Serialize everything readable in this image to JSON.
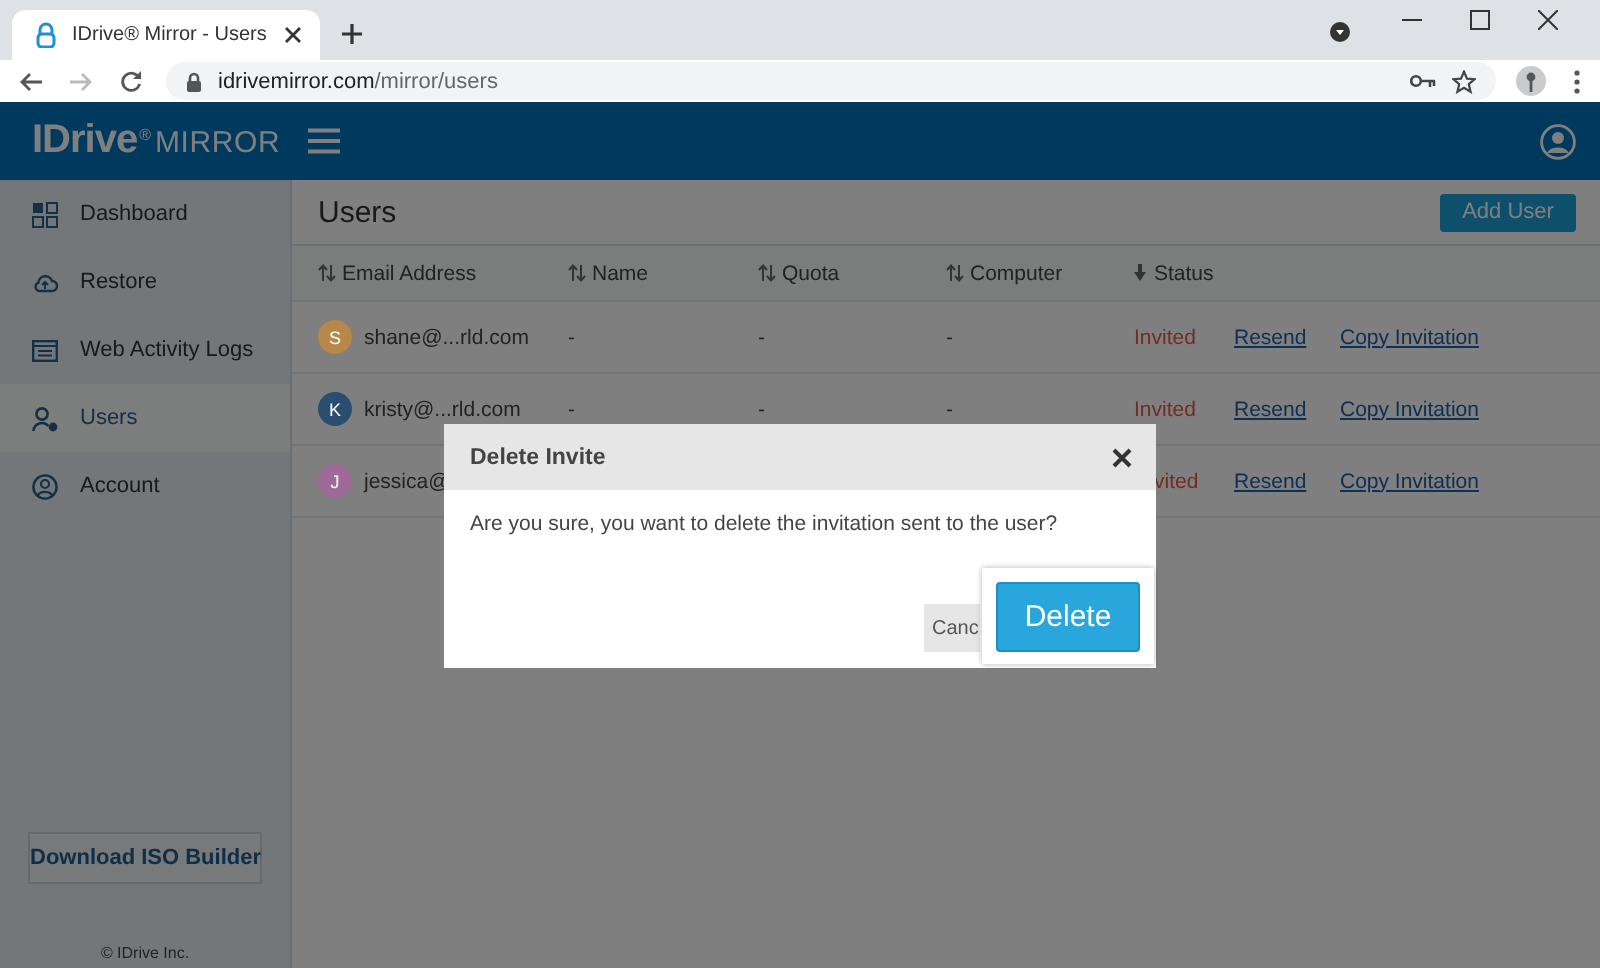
{
  "browser": {
    "tab_title": "IDrive® Mirror - Users",
    "url_host": "idrivemirror.com",
    "url_path": "/mirror/users"
  },
  "header": {
    "logo": "IDrive",
    "logo_mark": "®",
    "product": "MIRROR"
  },
  "sidebar": {
    "items": [
      {
        "label": "Dashboard",
        "selected": false
      },
      {
        "label": "Restore",
        "selected": false
      },
      {
        "label": "Web Activity Logs",
        "selected": false
      },
      {
        "label": "Users",
        "selected": true
      },
      {
        "label": "Account",
        "selected": false
      }
    ],
    "download_button": "Download ISO Builder",
    "footer": "© IDrive Inc."
  },
  "page": {
    "title": "Users",
    "add_button": "Add User"
  },
  "table": {
    "columns": [
      {
        "label": "Email Address",
        "sorted": false
      },
      {
        "label": "Name",
        "sorted": false
      },
      {
        "label": "Quota",
        "sorted": false
      },
      {
        "label": "Computer",
        "sorted": false
      },
      {
        "label": "Status",
        "sorted": true
      }
    ],
    "rows": [
      {
        "kind": "full",
        "initial": "S",
        "color": "#b8884a",
        "email": "shane@...rld.com",
        "name": "-",
        "quota": "-",
        "computer": "-",
        "status": "Invited",
        "actions": [
          "Resend",
          "Copy Invitation"
        ]
      },
      {
        "kind": "full",
        "initial": "K",
        "color": "#2a4d70",
        "email": "kristy@...rld.com",
        "name": "-",
        "quota": "-",
        "computer": "-",
        "status": "Invited",
        "actions": [
          "Resend",
          "Copy Invitation"
        ]
      },
      {
        "kind": "covered",
        "initial": "J",
        "color": "#a06a98",
        "email": "jessica@",
        "status": "vited",
        "actions": [
          "Resend",
          "Copy Invitation"
        ]
      }
    ]
  },
  "dialog": {
    "title": "Delete Invite",
    "message": "Are you sure, you want to delete the invitation sent to the user?",
    "cancel": "Canc",
    "confirm": "Delete"
  }
}
